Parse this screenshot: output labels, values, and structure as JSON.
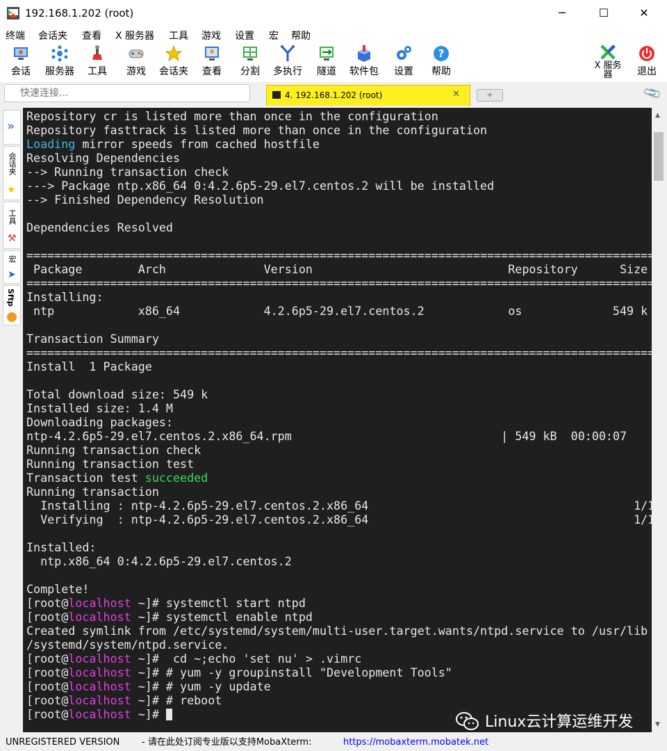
{
  "window": {
    "title": "192.168.1.202 (root)",
    "minimize": "─",
    "maximize": "☐",
    "close": "✕"
  },
  "menu": [
    "终端",
    "会话夹",
    "查看",
    "X 服务器",
    "工具",
    "游戏",
    "设置",
    "宏",
    "帮助"
  ],
  "toolbar": [
    {
      "label": "会话",
      "icon": "session-icon"
    },
    {
      "label": "服务器",
      "icon": "servers-icon"
    },
    {
      "label": "工具",
      "icon": "tools-icon"
    },
    {
      "label": "游戏",
      "icon": "games-icon"
    },
    {
      "label": "会话夹",
      "icon": "star-icon"
    },
    {
      "label": "查看",
      "icon": "view-icon"
    },
    {
      "label": "分割",
      "icon": "split-icon"
    },
    {
      "label": "多执行",
      "icon": "multiexec-icon"
    },
    {
      "label": "隧道",
      "icon": "tunnel-icon"
    },
    {
      "label": "软件包",
      "icon": "packages-icon"
    },
    {
      "label": "设置",
      "icon": "settings-icon"
    },
    {
      "label": "帮助",
      "icon": "help-icon"
    }
  ],
  "toolbar_right": {
    "xserver": "X 服务器",
    "exit": "退出"
  },
  "quick_connect": {
    "placeholder": "快速连接..."
  },
  "tab": {
    "label": "4. 192.168.1.202 (root)",
    "close": "✕",
    "new": "+"
  },
  "sidebar": {
    "favorites": "会话夹",
    "tools": "工具",
    "macros": "宏",
    "sftp": "Sftp"
  },
  "terminal": {
    "lines": [
      "Repository cr is listed more than once in the configuration",
      "Repository fasttrack is listed more than once in the configuration",
      "Loading mirror speeds from cached hostfile",
      "Resolving Dependencies",
      "--> Running transaction check",
      "---> Package ntp.x86_64 0:4.2.6p5-29.el7.centos.2 will be installed",
      "--> Finished Dependency Resolution",
      "",
      "Dependencies Resolved",
      "",
      "=============================================================================================",
      " Package        Arch              Version                            Repository      Size",
      "=============================================================================================",
      "Installing:",
      " ntp            x86_64            4.2.6p5-29.el7.centos.2            os             549 k",
      "",
      "Transaction Summary",
      "=============================================================================================",
      "Install  1 Package",
      "",
      "Total download size: 549 k",
      "Installed size: 1.4 M",
      "Downloading packages:",
      "ntp-4.2.6p5-29.el7.centos.2.x86_64.rpm                              | 549 kB  00:00:07",
      "Running transaction check",
      "Running transaction test",
      "Transaction test succeeded",
      "Running transaction",
      "  Installing : ntp-4.2.6p5-29.el7.centos.2.x86_64                                      1/1",
      "  Verifying  : ntp-4.2.6p5-29.el7.centos.2.x86_64                                      1/1",
      "",
      "Installed:",
      "  ntp.x86_64 0:4.2.6p5-29.el7.centos.2",
      "",
      "Complete!",
      "[root@localhost ~]# systemctl start ntpd",
      "[root@localhost ~]# systemctl enable ntpd",
      "Created symlink from /etc/systemd/system/multi-user.target.wants/ntpd.service to /usr/lib",
      "/systemd/system/ntpd.service.",
      "[root@localhost ~]#  cd ~;echo 'set nu' > .vimrc",
      "[root@localhost ~]# # yum -y groupinstall \"Development Tools\"",
      "[root@localhost ~]# # yum -y update",
      "[root@localhost ~]# # reboot",
      "[root@localhost ~]# "
    ],
    "highlight_cyan": "Loading",
    "highlight_green": "succeeded",
    "host": "localhost"
  },
  "watermark": "Linux云计算运维开发",
  "status": {
    "unregistered": "UNREGISTERED VERSION",
    "message": " -  请在此处订阅专业版以支持MobaXterm:",
    "link": "https://mobaxterm.mobatek.net"
  },
  "colors": {
    "terminal_bg": "#1f1f1f",
    "terminal_fg": "#e8e8e8",
    "cyan": "#3fb8ea",
    "green": "#3ed85a",
    "magenta": "#e040e0",
    "tab_active": "#ffee22",
    "link": "#0000ee"
  }
}
